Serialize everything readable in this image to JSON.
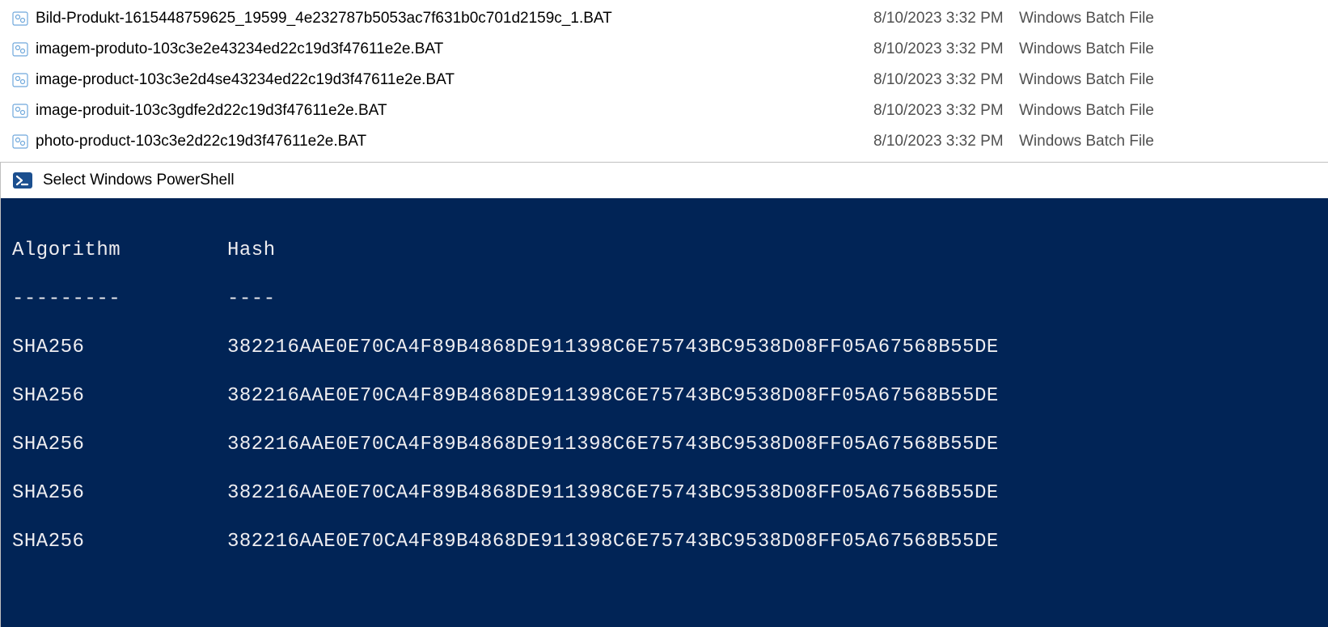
{
  "file_list": {
    "rows": [
      {
        "name": "Bild-Produkt-1615448759625_19599_4e232787b5053ac7f631b0c701d2159c_1.BAT",
        "date": "8/10/2023 3:32 PM",
        "type": "Windows Batch File"
      },
      {
        "name": "imagem-produto-103c3e2e43234ed22c19d3f47611e2e.BAT",
        "date": "8/10/2023 3:32 PM",
        "type": "Windows Batch File"
      },
      {
        "name": "image-product-103c3e2d4se43234ed22c19d3f47611e2e.BAT",
        "date": "8/10/2023 3:32 PM",
        "type": "Windows Batch File"
      },
      {
        "name": "image-produit-103c3gdfe2d22c19d3f47611e2e.BAT",
        "date": "8/10/2023 3:32 PM",
        "type": "Windows Batch File"
      },
      {
        "name": "photo-product-103c3e2d22c19d3f47611e2e.BAT",
        "date": "8/10/2023 3:32 PM",
        "type": "Windows Batch File"
      }
    ]
  },
  "powershell": {
    "title": "Select Windows PowerShell",
    "columns": {
      "algorithm": "Algorithm",
      "hash": "Hash"
    },
    "dashes": {
      "algorithm": "---------",
      "hash": "----"
    },
    "rows": [
      {
        "algorithm": "SHA256",
        "hash": "382216AAE0E70CA4F89B4868DE911398C6E75743BC9538D08FF05A67568B55DE"
      },
      {
        "algorithm": "SHA256",
        "hash": "382216AAE0E70CA4F89B4868DE911398C6E75743BC9538D08FF05A67568B55DE"
      },
      {
        "algorithm": "SHA256",
        "hash": "382216AAE0E70CA4F89B4868DE911398C6E75743BC9538D08FF05A67568B55DE"
      },
      {
        "algorithm": "SHA256",
        "hash": "382216AAE0E70CA4F89B4868DE911398C6E75743BC9538D08FF05A67568B55DE"
      },
      {
        "algorithm": "SHA256",
        "hash": "382216AAE0E70CA4F89B4868DE911398C6E75743BC9538D08FF05A67568B55DE"
      }
    ]
  }
}
